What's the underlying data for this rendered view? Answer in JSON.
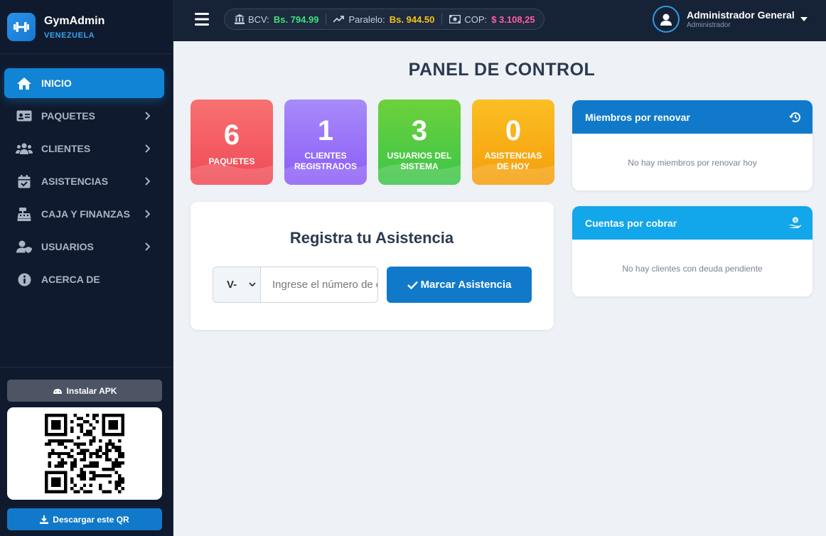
{
  "brand": {
    "name": "GymAdmin",
    "subtitle": "VENEZUELA"
  },
  "sidebar": {
    "items": [
      {
        "label": "INICIO",
        "icon": "home-icon",
        "active": true
      },
      {
        "label": "PAQUETES",
        "icon": "id-card-icon",
        "chevron": true
      },
      {
        "label": "CLIENTES",
        "icon": "users-icon",
        "chevron": true
      },
      {
        "label": "ASISTENCIAS",
        "icon": "calendar-check-icon",
        "chevron": true
      },
      {
        "label": "CAJA Y FINANZAS",
        "icon": "cash-register-icon",
        "chevron": true
      },
      {
        "label": "USUARIOS",
        "icon": "user-shield-icon",
        "chevron": true
      },
      {
        "label": "ACERCA DE",
        "icon": "info-icon"
      }
    ],
    "install_apk": "Instalar APK",
    "download_qr": "Descargar este QR"
  },
  "topbar": {
    "rates": [
      {
        "label": "BCV:",
        "value": "Bs. 794.99",
        "color": "#3ee07a",
        "icon": "bank-icon"
      },
      {
        "label": "Paralelo:",
        "value": "Bs. 944.50",
        "color": "#f5c518",
        "icon": "trend-up-icon"
      },
      {
        "label": "COP:",
        "value": "$ 3.108,25",
        "color": "#ff5fa2",
        "icon": "money-bill-icon"
      }
    ],
    "user": {
      "name": "Administrador General",
      "role": "Administrador"
    }
  },
  "main": {
    "title": "PANEL DE CONTROL",
    "stats": [
      {
        "value": "6",
        "label": "PAQUETES",
        "color_top": "#f87171",
        "color_bottom": "#ef4a56"
      },
      {
        "value": "1",
        "label": "CLIENTES REGISTRADOS",
        "color_top": "#a78bfa",
        "color_bottom": "#8b5cf6"
      },
      {
        "value": "3",
        "label": "USUARIOS DEL SISTEMA",
        "color_top": "#6dd13b",
        "color_bottom": "#3cc54a"
      },
      {
        "value": "0",
        "label": "ASISTENCIAS DE HOY",
        "color_top": "#fbbf24",
        "color_bottom": "#f59e0b"
      }
    ],
    "attendance": {
      "title": "Registra tu Asistencia",
      "doc_type": "V-",
      "placeholder": "Ingrese el número de cédula",
      "button": "Marcar Asistencia"
    },
    "renew_panel": {
      "title": "Miembros por renovar",
      "empty": "No hay miembros por renovar hoy",
      "color": "#1179c9"
    },
    "debt_panel": {
      "title": "Cuentas por cobrar",
      "empty": "No hay clientes con deuda pendiente",
      "color": "#12a6ea"
    }
  }
}
